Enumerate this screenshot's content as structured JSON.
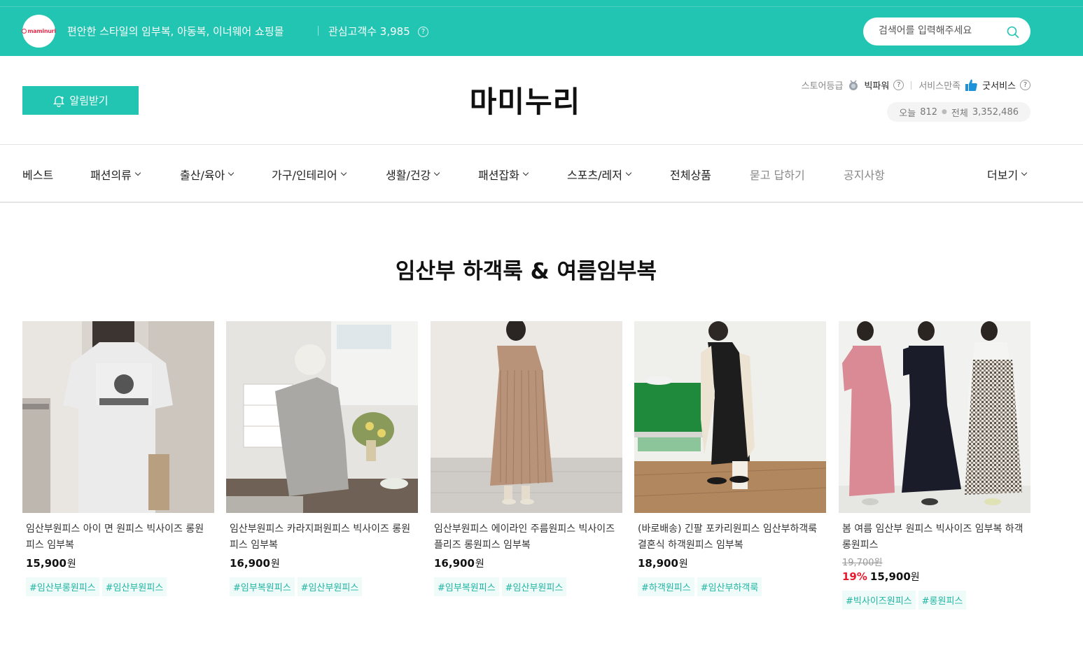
{
  "topbar": {
    "logo_text": "maminuri",
    "tagline": "편안한 스타일의 임부복, 아동복, 이너웨어 쇼핑몰",
    "interest_label": "관심고객수",
    "interest_count": "3,985",
    "help": "?",
    "search_placeholder": "검색어를 입력해주세요"
  },
  "header": {
    "alarm_button": "알림받기",
    "store_name": "마미누리",
    "grade_label": "스토어등급",
    "grade_value": "빅파워",
    "service_label": "서비스만족",
    "service_value": "굿서비스",
    "today_label": "오늘",
    "today_count": "812",
    "total_label": "전체",
    "total_count": "3,352,486"
  },
  "nav": {
    "items": [
      "베스트",
      "패션의류",
      "출산/육아",
      "가구/인테리어",
      "생활/건강",
      "패션잡화",
      "스포츠/레저",
      "전체상품",
      "묻고 답하기",
      "공지사항"
    ],
    "more": "더보기"
  },
  "section": {
    "title": "임산부 하객룩 & 여름임부복"
  },
  "products": [
    {
      "name": "임산부원피스 아이 면 원피스 빅사이즈 롱원피스 임부복",
      "price": "15,900",
      "won": "원",
      "tags": [
        "#임산부롱원피스",
        "#임산부원피스"
      ]
    },
    {
      "name": "임산부원피스 카라지퍼원피스 빅사이즈 롱원피스 임부복",
      "price": "16,900",
      "won": "원",
      "tags": [
        "#임부복원피스",
        "#임산부원피스"
      ]
    },
    {
      "name": "임산부원피스 에이라인 주름원피스 빅사이즈 플리즈 롱원피스 임부복",
      "price": "16,900",
      "won": "원",
      "tags": [
        "#임부복원피스",
        "#임산부원피스"
      ]
    },
    {
      "name": "(바로배송) 긴팔 포카리원피스 임산부하객룩 결혼식 하객원피스 임부복",
      "price": "18,900",
      "won": "원",
      "tags": [
        "#하객원피스",
        "#임산부하객룩"
      ]
    },
    {
      "name": "봄 여름 임산부 원피스 빅사이즈 임부복 하객 롱원피스",
      "original_price": "19,700원",
      "discount": "19%",
      "price": "15,900",
      "won": "원",
      "tags": [
        "#빅사이즈원피스",
        "#롱원피스"
      ]
    }
  ],
  "colors": {
    "accent": "#21c5b2",
    "sale": "#e8192c",
    "tag_bg": "#eefbf8",
    "tag_text": "#21b5a4"
  }
}
